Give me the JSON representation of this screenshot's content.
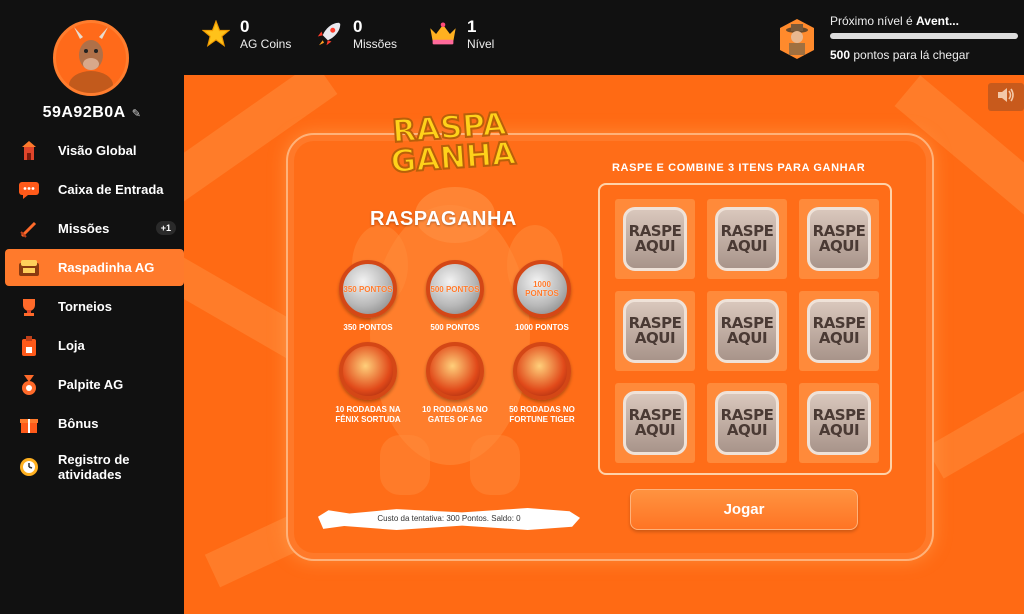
{
  "sidebar": {
    "username": "59A92B0A",
    "items": [
      {
        "label": "Visão Global",
        "icon": "tower-icon"
      },
      {
        "label": "Caixa de Entrada",
        "icon": "inbox-icon"
      },
      {
        "label": "Missões",
        "icon": "sword-icon",
        "badge": "+1"
      },
      {
        "label": "Raspadinha AG",
        "icon": "scratch-card-icon",
        "active": true
      },
      {
        "label": "Torneios",
        "icon": "trophy-icon"
      },
      {
        "label": "Loja",
        "icon": "shop-icon"
      },
      {
        "label": "Palpite AG",
        "icon": "medal-icon"
      },
      {
        "label": "Bônus",
        "icon": "gift-icon"
      },
      {
        "label": "Registro de atividades",
        "icon": "clock-icon"
      }
    ]
  },
  "topbar": {
    "coins": {
      "value": "0",
      "label": "AG Coins"
    },
    "missions": {
      "value": "0",
      "label": "Missões"
    },
    "level": {
      "value": "1",
      "label": "Nível"
    },
    "next_level_prefix": "Próximo nível é ",
    "next_level_name": "Avent...",
    "points_value": "500",
    "points_suffix": " pontos para lá chegar",
    "progress": 0
  },
  "game": {
    "logo_line1": "RASPA",
    "logo_line2": "GANHA",
    "title": "RASPAGANHA",
    "prizes": [
      {
        "coin_text": "350 PONTOS",
        "label": "350 PONTOS"
      },
      {
        "coin_text": "500 PONTOS",
        "label": "500 PONTOS"
      },
      {
        "coin_text": "1000 PONTOS",
        "label": "1000 PONTOS"
      },
      {
        "coin_text": "",
        "label": "10 RODADAS NA FÊNIX SORTUDA"
      },
      {
        "coin_text": "",
        "label": "10 RODADAS NO GATES OF AG"
      },
      {
        "coin_text": "",
        "label": "50 RODADAS NO FORTUNE TIGER"
      }
    ],
    "cost_text": "Custo da tentativa: 300 Pontos. Saldo: 0",
    "instructions": "RASPE E COMBINE 3 ITENS PARA GANHAR",
    "tile_text": [
      "RASPE",
      "AQUI"
    ],
    "play_label": "Jogar"
  },
  "colors": {
    "accent": "#ff7a2c",
    "background": "#ff6a14",
    "sidebar": "#111111"
  }
}
